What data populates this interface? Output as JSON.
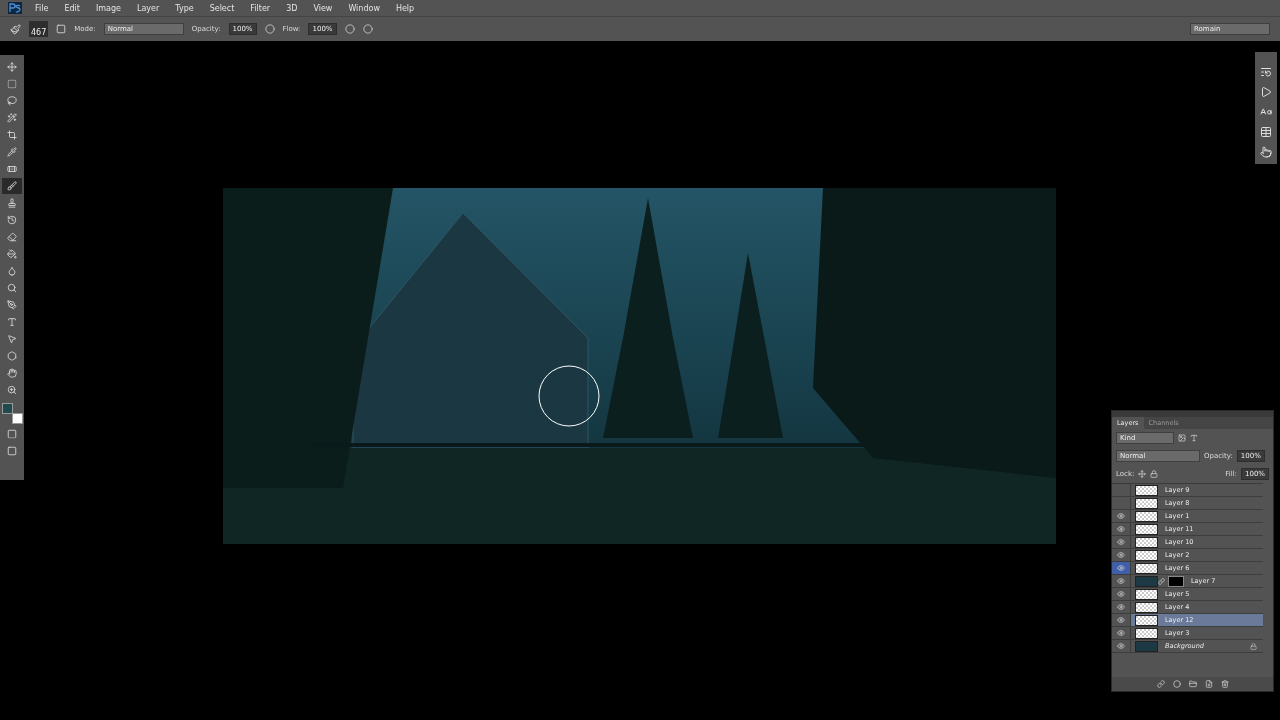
{
  "menu": [
    "File",
    "Edit",
    "Image",
    "Layer",
    "Type",
    "Select",
    "Filter",
    "3D",
    "View",
    "Window",
    "Help"
  ],
  "options_bar": {
    "brush_size": "467",
    "mode_label": "Mode:",
    "mode": "Normal",
    "opacity_label": "Opacity:",
    "opacity": "100%",
    "flow_label": "Flow:",
    "flow": "100%",
    "workspace": "Romain"
  },
  "tools": [
    {
      "kind": "move",
      "selected": false
    },
    {
      "kind": "marquee",
      "selected": false
    },
    {
      "kind": "lasso",
      "selected": false
    },
    {
      "kind": "wand",
      "selected": false
    },
    {
      "kind": "crop",
      "selected": false
    },
    {
      "kind": "eyedropper",
      "selected": false
    },
    {
      "kind": "healing",
      "selected": false
    },
    {
      "kind": "brush",
      "selected": true
    },
    {
      "kind": "stamp",
      "selected": false
    },
    {
      "kind": "history",
      "selected": false
    },
    {
      "kind": "eraser",
      "selected": false
    },
    {
      "kind": "bucket",
      "selected": false
    },
    {
      "kind": "blur",
      "selected": false
    },
    {
      "kind": "dodge",
      "selected": false
    },
    {
      "kind": "pen",
      "selected": false
    },
    {
      "kind": "type",
      "selected": false
    },
    {
      "kind": "select",
      "selected": false
    },
    {
      "kind": "shape",
      "selected": false
    },
    {
      "kind": "hand",
      "selected": false
    },
    {
      "kind": "zoom",
      "selected": false
    }
  ],
  "dock": [
    {
      "kind": "history"
    },
    {
      "kind": "actions"
    },
    {
      "kind": "character"
    },
    {
      "kind": "swatches"
    },
    {
      "kind": "tool-presets"
    }
  ],
  "layers_panel": {
    "tabs": [
      {
        "label": "Layers",
        "selected": true
      },
      {
        "label": "Channels",
        "selected": false
      }
    ],
    "filter": "Kind",
    "blend": "Normal",
    "opacity_label": "Opacity:",
    "opacity": "100%",
    "lock_label": "Lock:",
    "fill_label": "Fill:",
    "fill": "100%",
    "layers": [
      {
        "name": "Layer 9",
        "kind": "normal",
        "visible": false,
        "selected": false,
        "eye_highlight": false
      },
      {
        "name": "Layer 8",
        "kind": "normal",
        "visible": false,
        "selected": false,
        "eye_highlight": false
      },
      {
        "name": "Layer 1",
        "kind": "normal",
        "visible": true,
        "selected": false,
        "eye_highlight": false
      },
      {
        "name": "Layer 11",
        "kind": "normal",
        "visible": true,
        "selected": false,
        "eye_highlight": false
      },
      {
        "name": "Layer 10",
        "kind": "normal",
        "visible": true,
        "selected": false,
        "eye_highlight": false
      },
      {
        "name": "Layer 2",
        "kind": "normal",
        "visible": true,
        "selected": false,
        "eye_highlight": false
      },
      {
        "name": "Layer 6",
        "kind": "normal",
        "visible": true,
        "selected": false,
        "eye_highlight": true
      },
      {
        "name": "Layer 7",
        "kind": "masked",
        "visible": true,
        "selected": false,
        "eye_highlight": false
      },
      {
        "name": "Layer 5",
        "kind": "normal",
        "visible": true,
        "selected": false,
        "eye_highlight": false
      },
      {
        "name": "Layer 4",
        "kind": "normal",
        "visible": true,
        "selected": false,
        "eye_highlight": false
      },
      {
        "name": "Layer 12",
        "kind": "normal",
        "visible": true,
        "selected": true,
        "eye_highlight": false
      },
      {
        "name": "Layer 3",
        "kind": "normal",
        "visible": true,
        "selected": false,
        "eye_highlight": false
      },
      {
        "name": "Background",
        "kind": "background",
        "visible": true,
        "selected": false,
        "eye_highlight": false
      }
    ]
  }
}
